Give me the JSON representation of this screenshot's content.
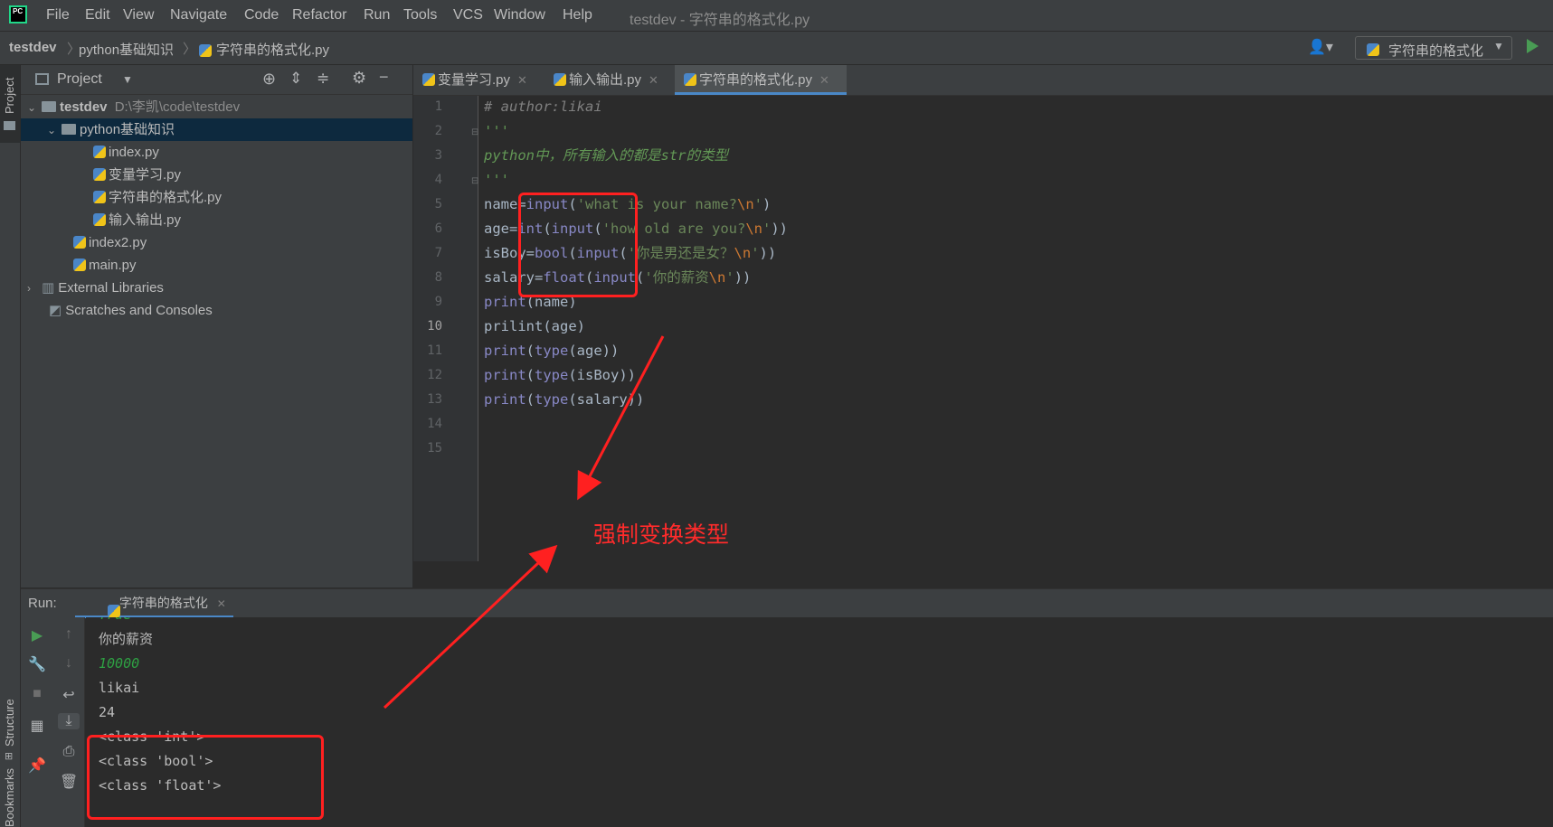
{
  "menubar": {
    "items": [
      "File",
      "Edit",
      "View",
      "Navigate",
      "Code",
      "Refactor",
      "Run",
      "Tools",
      "VCS",
      "Window",
      "Help"
    ],
    "window_title": "testdev - 字符串的格式化.py"
  },
  "navbar": {
    "breadcrumbs": [
      "testdev",
      "python基础知识",
      "字符串的格式化.py"
    ],
    "run_config": "字符串的格式化"
  },
  "stripes": {
    "project": "Project",
    "structure": "Structure",
    "bookmarks": "Bookmarks"
  },
  "project_panel": {
    "title": "Project",
    "tree": [
      {
        "label": "testdev",
        "path": "D:\\李凯\\code\\testdev"
      },
      {
        "label": "python基础知识"
      },
      {
        "label": "index.py"
      },
      {
        "label": "变量学习.py"
      },
      {
        "label": "字符串的格式化.py"
      },
      {
        "label": "输入输出.py"
      },
      {
        "label": "index2.py"
      },
      {
        "label": "main.py"
      },
      {
        "label": "External Libraries"
      },
      {
        "label": "Scratches and Consoles"
      }
    ]
  },
  "editor": {
    "tabs": [
      "变量学习.py",
      "输入输出.py",
      "字符串的格式化.py"
    ],
    "active_tab": "字符串的格式化.py",
    "line_numbers": [
      "1",
      "2",
      "3",
      "4",
      "5",
      "6",
      "7",
      "8",
      "9",
      "10",
      "11",
      "12",
      "13",
      "14",
      "15"
    ],
    "current_line": "10",
    "lines": [
      "# author:likai",
      "'''",
      "python中，所有输入的都是str的类型",
      "'''",
      "name=input('what is your name?\\n')",
      "age=int(input('how old are you?\\n'))",
      "isBoy=bool(input('你是男还是女？\\n'))",
      "salary=float(input('你的薪资\\n'))",
      "print(name)",
      "prilint(age)",
      "print(type(age))",
      "print(type(isBoy))",
      "print(type(salary))",
      "",
      ""
    ]
  },
  "run_panel": {
    "label": "Run:",
    "tab": "字符串的格式化",
    "output": [
      {
        "text": "True",
        "kind": "input"
      },
      {
        "text": "你的薪资",
        "kind": "stdout"
      },
      {
        "text": "10000",
        "kind": "input"
      },
      {
        "text": "likai",
        "kind": "stdout"
      },
      {
        "text": "24",
        "kind": "stdout"
      },
      {
        "text": "<class 'int'>",
        "kind": "stdout"
      },
      {
        "text": "<class 'bool'>",
        "kind": "stdout"
      },
      {
        "text": "<class 'float'>",
        "kind": "stdout"
      }
    ]
  },
  "annotation": {
    "text": "强制变换类型",
    "color": "#ff2b2b"
  }
}
